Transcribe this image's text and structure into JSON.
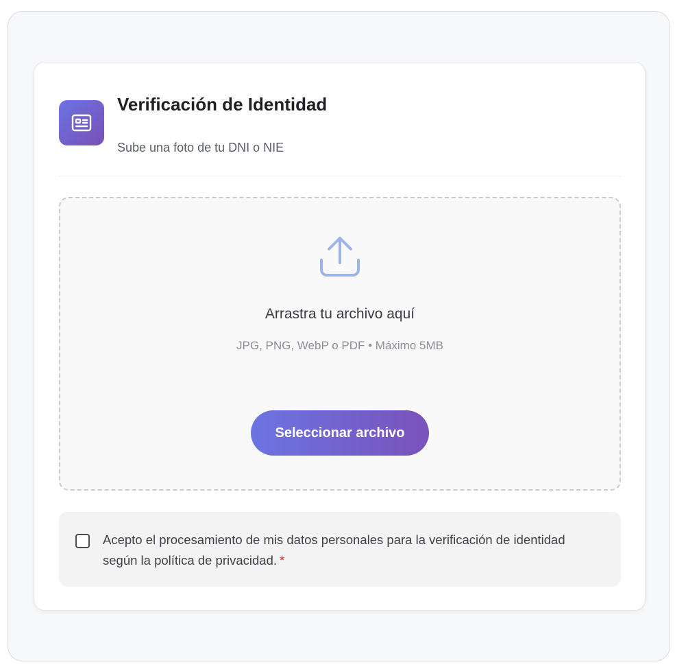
{
  "header": {
    "title": "Verificación de Identidad",
    "subtitle": "Sube una foto de tu DNI o NIE",
    "icon": "id-card-icon"
  },
  "dropzone": {
    "icon": "upload-icon",
    "title": "Arrastra tu archivo aquí",
    "formats": "JPG, PNG, WebP o PDF • Máximo 5MB",
    "button_label": "Seleccionar archivo"
  },
  "consent": {
    "checked": false,
    "text": "Acepto el procesamiento de mis datos personales para la verificación de identidad según la política de privacidad.",
    "required_mark": "*"
  },
  "colors": {
    "accent_start": "#6b74e2",
    "accent_end": "#7a52bb",
    "upload_icon": "#9db3ec",
    "required": "#c0392b"
  }
}
